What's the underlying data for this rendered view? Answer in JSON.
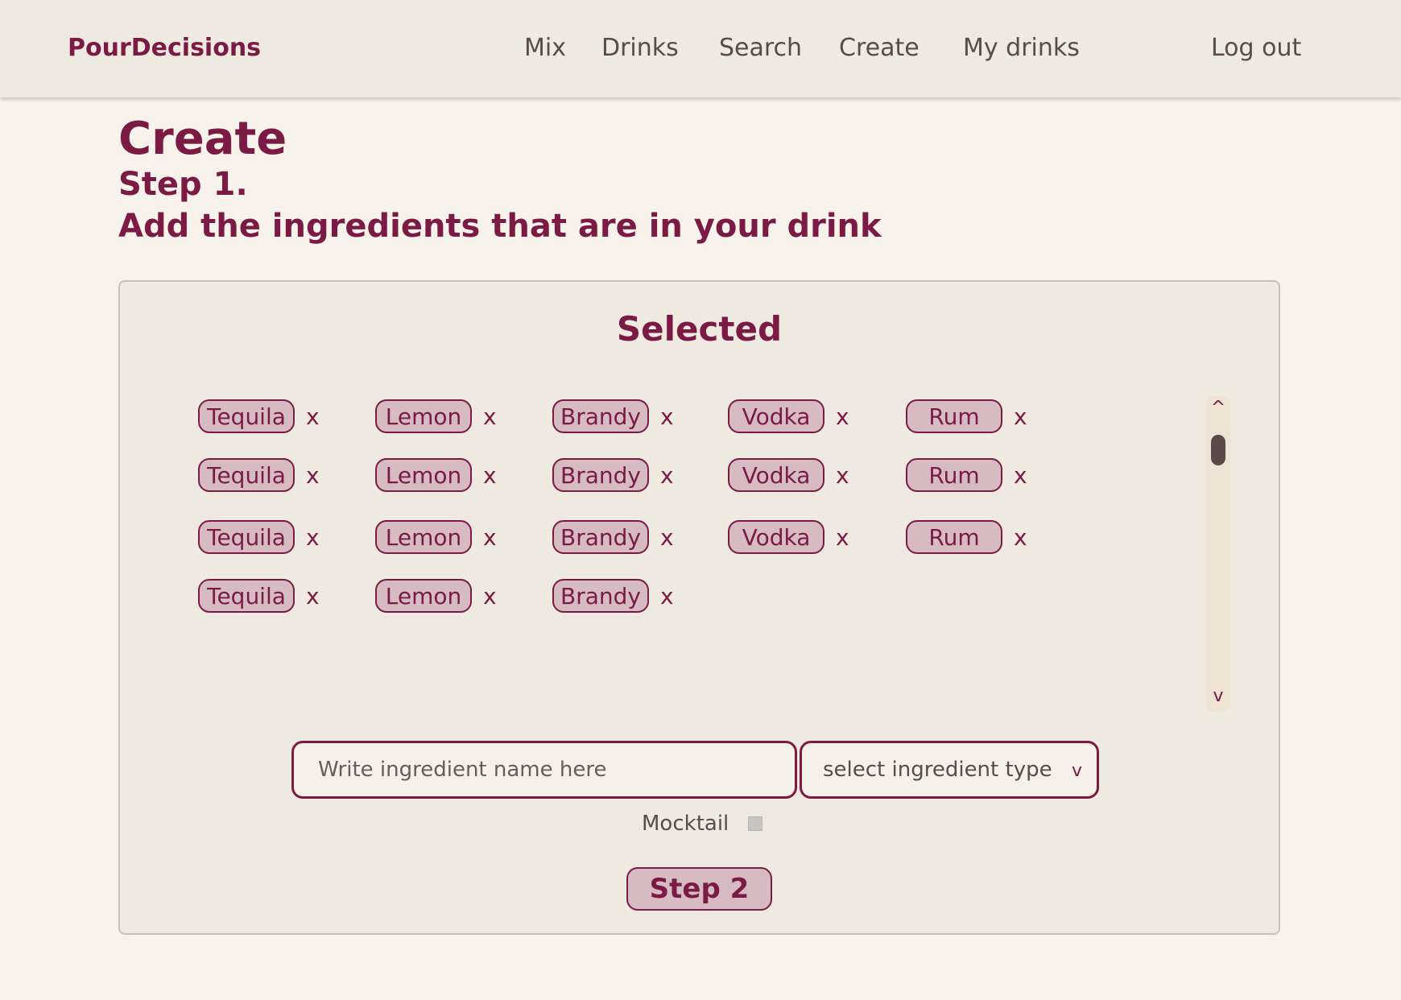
{
  "nav": {
    "brand": "PourDecisions",
    "links": [
      "Mix",
      "Drinks",
      "Search",
      "Create",
      "My drinks"
    ],
    "logout": "Log out"
  },
  "page": {
    "title": "Create",
    "step": "Step 1.",
    "subtitle": "Add the ingredients that are in your drink"
  },
  "selected": {
    "title": "Selected",
    "remove_label": "x",
    "rows": [
      [
        "Tequila",
        "Lemon",
        "Brandy",
        "Vodka",
        "Rum"
      ],
      [
        "Tequila",
        "Lemon",
        "Brandy",
        "Vodka",
        "Rum"
      ],
      [
        "Tequila",
        "Lemon",
        "Brandy",
        "Vodka",
        "Rum"
      ],
      [
        "Tequila",
        "Lemon",
        "Brandy"
      ]
    ],
    "scroll_up": "^",
    "scroll_down": "v"
  },
  "form": {
    "name_placeholder": "Write ingredient name here",
    "type_placeholder": "select ingredient type",
    "type_chevron": "v",
    "mocktail_label": "Mocktail",
    "mocktail_checked": false,
    "next_button": "Step 2"
  },
  "colors": {
    "accent": "#7a1a45",
    "chip_fill": "#d7bbc2",
    "background": "#f7f3ea",
    "panel": "#efeae0"
  }
}
